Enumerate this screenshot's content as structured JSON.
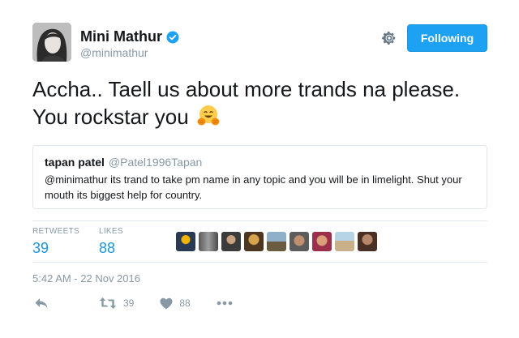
{
  "user": {
    "display_name": "Mini Mathur",
    "handle": "@minimathur",
    "verified": true,
    "follow_label": "Following"
  },
  "tweet": {
    "text": "Accha.. Taell us about more trands na please. You rockstar you",
    "emoji": "hugging-face-emoji"
  },
  "quote": {
    "name": "tapan patel",
    "handle": "@Patel1996Tapan",
    "text": "@minimathur its trand to take pm name in any topic and you will be in limelight. Shut your mouth its biggest help for country."
  },
  "stats": {
    "retweets_label": "RETWEETS",
    "retweets": "39",
    "likes_label": "LIKES",
    "likes": "88"
  },
  "timestamp": "5:42 AM - 22 Nov 2016",
  "actions": {
    "retweet_count": "39",
    "like_count": "88"
  },
  "colors": {
    "accent": "#1da1f2",
    "muted": "#8899a6",
    "border": "#e1e8ed"
  }
}
